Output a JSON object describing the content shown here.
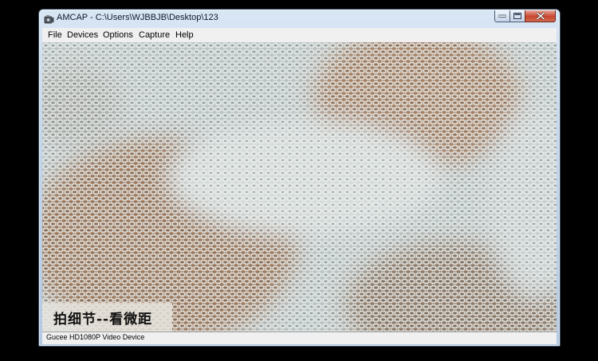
{
  "window": {
    "title": "AMCAP - C:\\Users\\WJBBJB\\Desktop\\123"
  },
  "menu": [
    {
      "label": "File"
    },
    {
      "label": "Devices"
    },
    {
      "label": "Options"
    },
    {
      "label": "Capture"
    },
    {
      "label": "Help"
    }
  ],
  "video": {
    "caption": "拍细节--看微距"
  },
  "status": {
    "device": "Gucee HD1080P Video Device"
  },
  "colors": {
    "fabric": "#c9d0d0",
    "skin": "#a58063",
    "close_button": "#c8452f"
  },
  "icons": {
    "app": "webcam-icon",
    "minimize": "minimize-icon",
    "maximize": "maximize-icon",
    "close": "close-icon"
  }
}
